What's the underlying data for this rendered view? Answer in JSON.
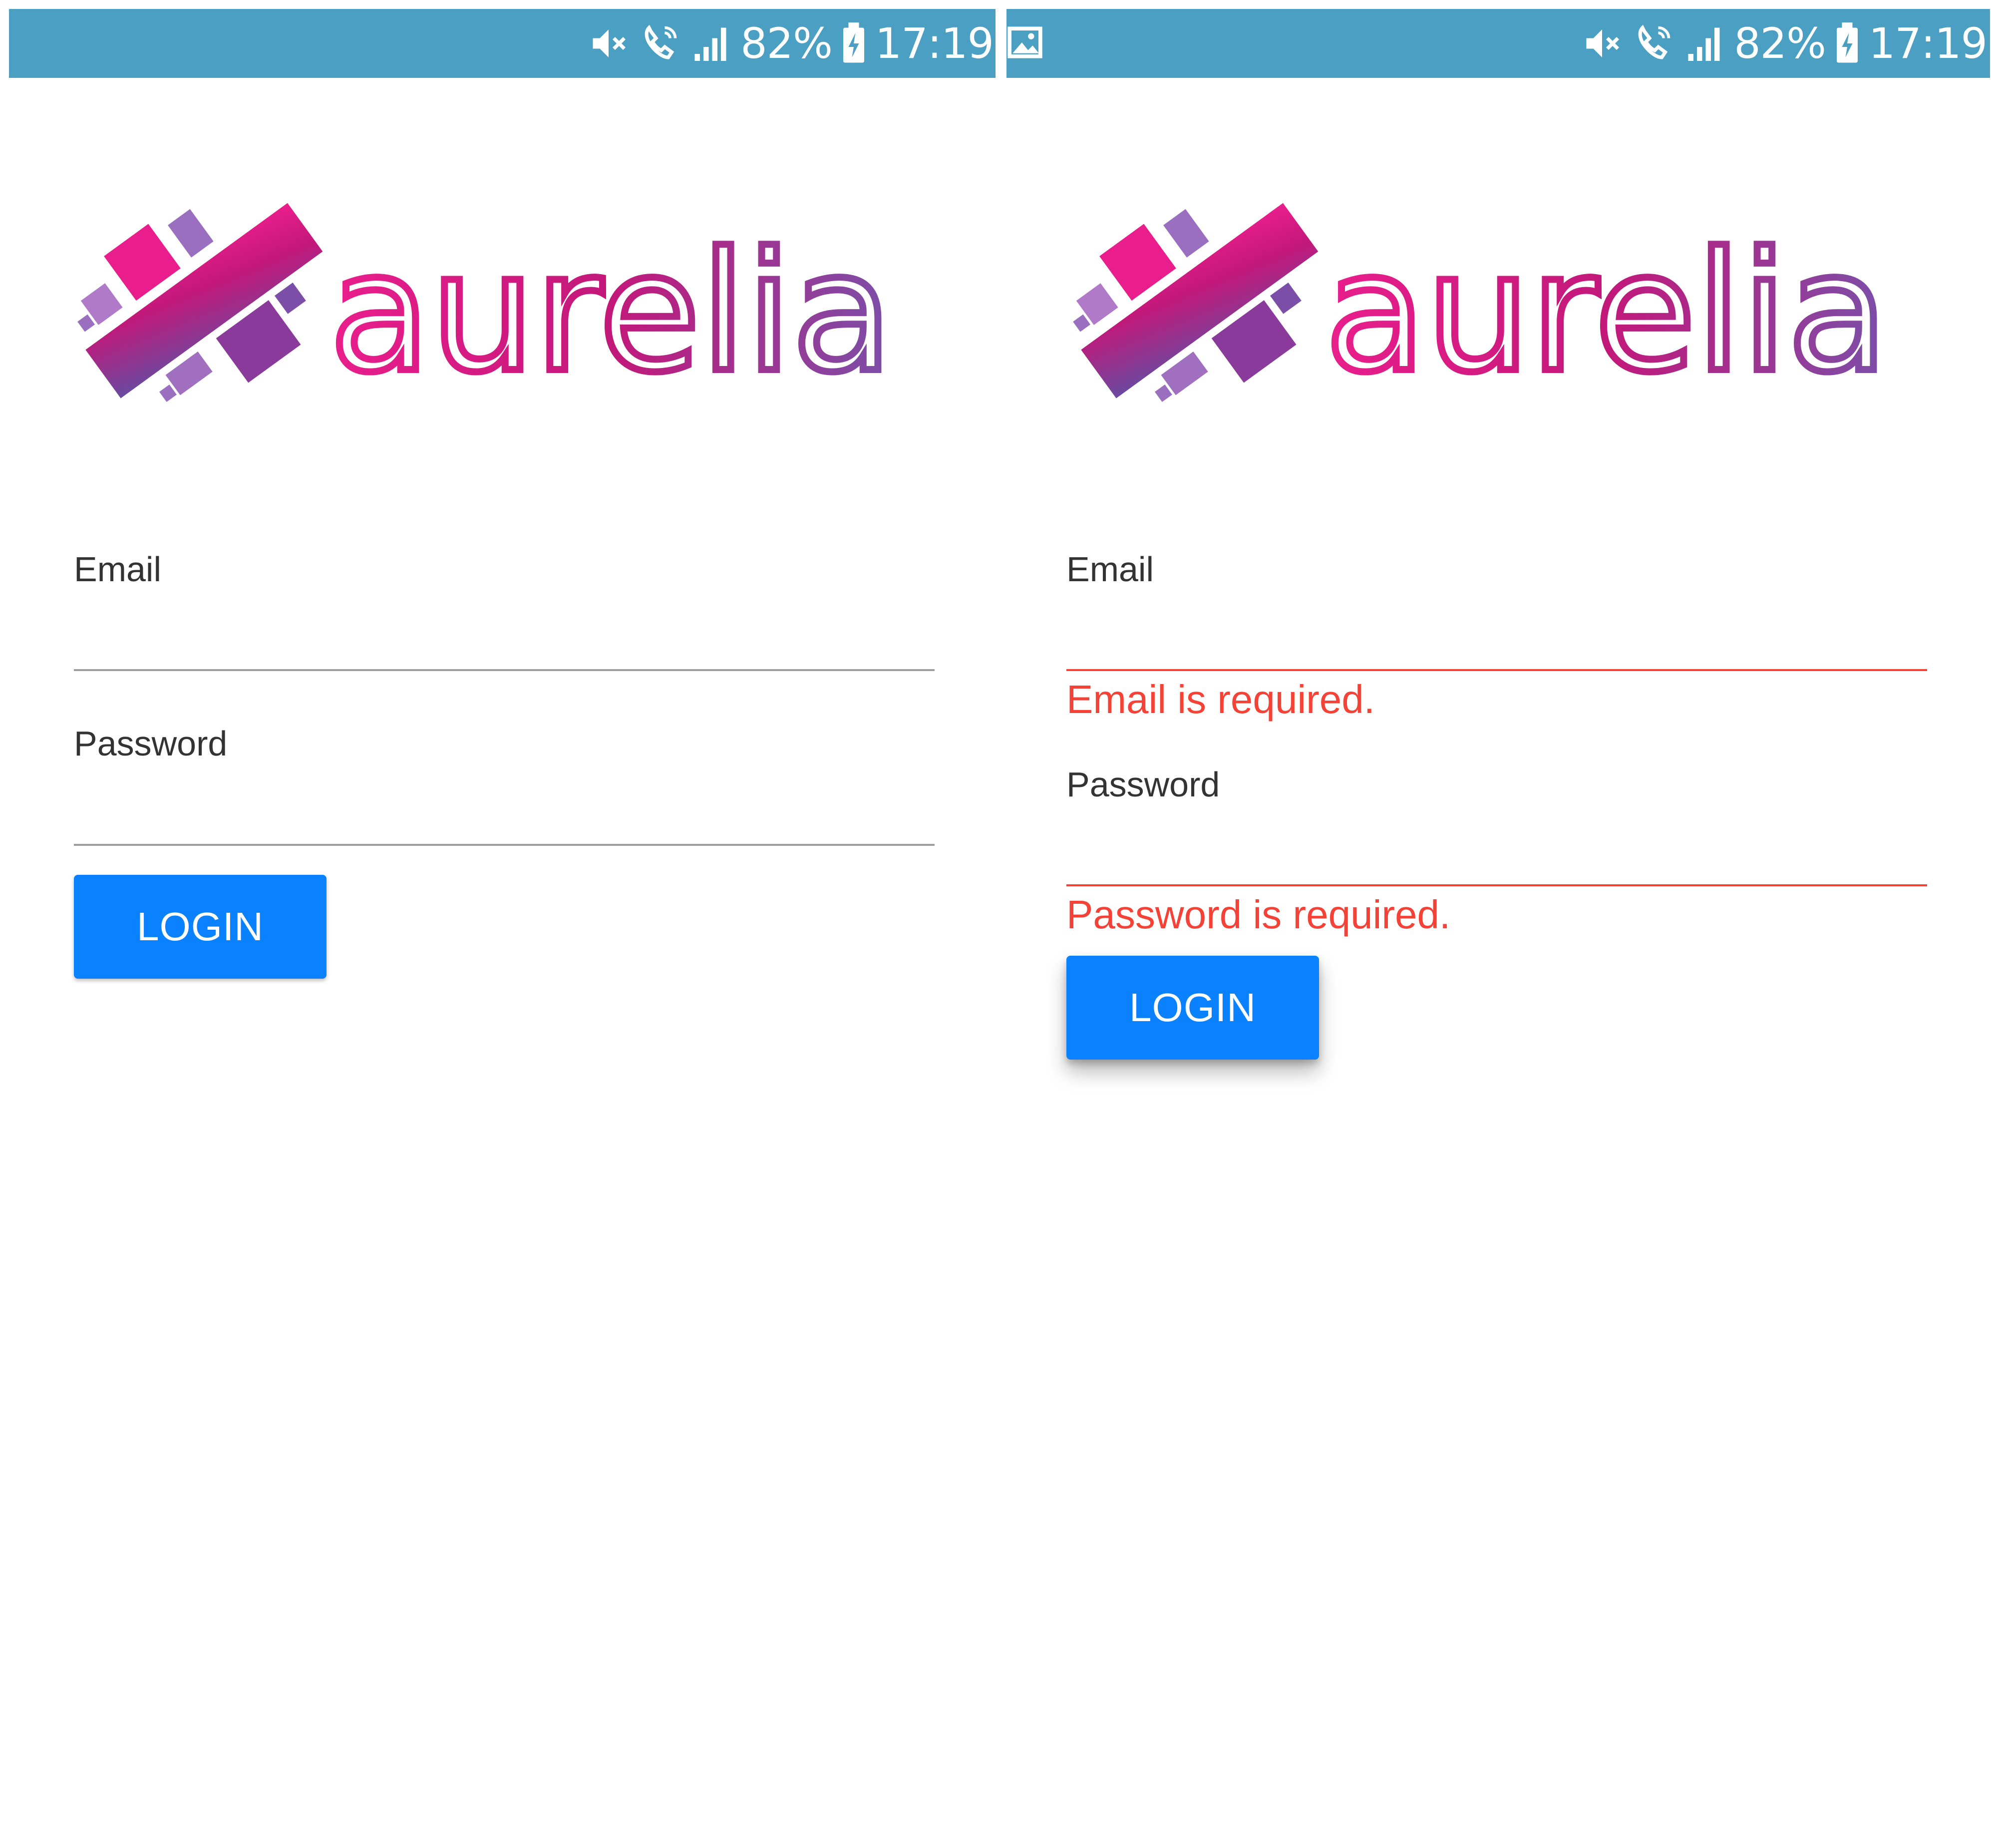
{
  "statusbar": {
    "battery_text": "82%",
    "time_text": "17:19",
    "icons": [
      "mute-icon",
      "wifi-call-icon",
      "signal-icon",
      "battery-charging-icon"
    ],
    "gallery_icon": "gallery-icon",
    "color": "#4a9fc2"
  },
  "logo": {
    "wordmark": "aurelia",
    "colors": {
      "pink": "#e91e8c",
      "magenta": "#c2187a",
      "purple": "#7b4fa8"
    }
  },
  "screens": [
    {
      "email_label": "Email",
      "email_value": "",
      "password_label": "Password",
      "password_value": "",
      "login_label": "LOGIN"
    },
    {
      "email_label": "Email",
      "email_value": "",
      "email_error": "Email is required.",
      "password_label": "Password",
      "password_value": "",
      "password_error": "Password is required.",
      "login_label": "LOGIN"
    }
  ],
  "colors": {
    "primary_button": "#0a82ff",
    "error": "#f44336",
    "input_underline": "#9e9e9e",
    "label": "#333333"
  }
}
